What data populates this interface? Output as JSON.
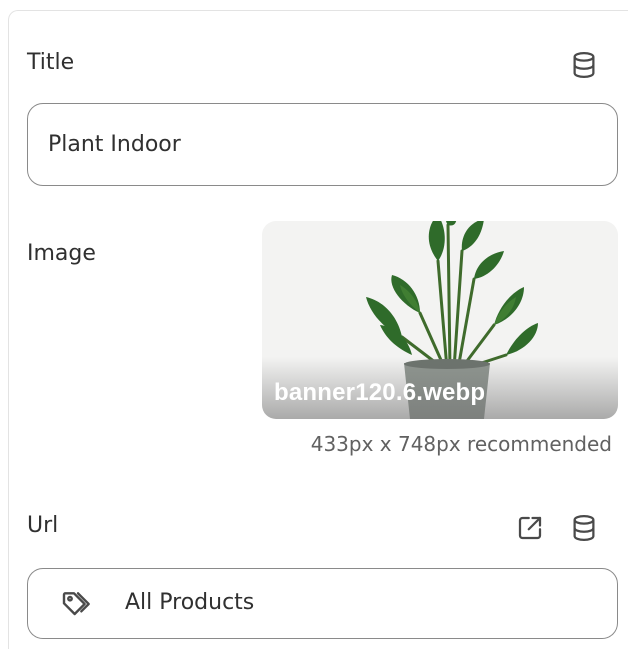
{
  "title_field": {
    "label": "Title",
    "value": "Plant Indoor",
    "dynamic_source_icon": "database-icon"
  },
  "image_field": {
    "label": "Image",
    "filename": "banner120.6.webp",
    "recommendation": "433px x 748px recommended",
    "thumbnail_icon": "potted-plant-image"
  },
  "url_field": {
    "label": "Url",
    "value": "All Products",
    "value_icon": "tag-icon",
    "actions": [
      "external-link-icon",
      "database-icon"
    ]
  },
  "colors": {
    "text": "#303030",
    "border": "#8a8a8a",
    "muted": "#616161",
    "card_bg": "#f3f3f2"
  }
}
